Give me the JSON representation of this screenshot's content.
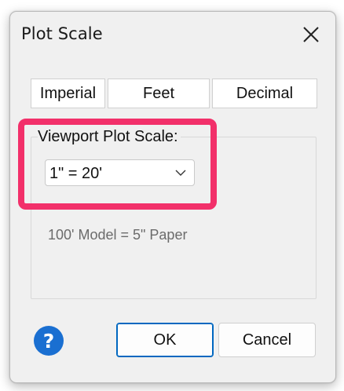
{
  "dialog": {
    "title": "Plot Scale",
    "close_icon": "close-icon"
  },
  "unit_buttons": [
    {
      "label": "Imperial"
    },
    {
      "label": "Feet"
    },
    {
      "label": "Decimal"
    }
  ],
  "viewport": {
    "label": "Viewport Plot Scale:",
    "selected_scale": "1\" = 20'",
    "dropdown_icon": "chevron-down-icon",
    "ratio_text": "100' Model = 5\" Paper"
  },
  "footer": {
    "help_icon": "help-icon",
    "ok_label": "OK",
    "cancel_label": "Cancel"
  },
  "colors": {
    "highlight": "#f2306a",
    "accent": "#0067c0",
    "help_icon": "#1a6fd1"
  }
}
